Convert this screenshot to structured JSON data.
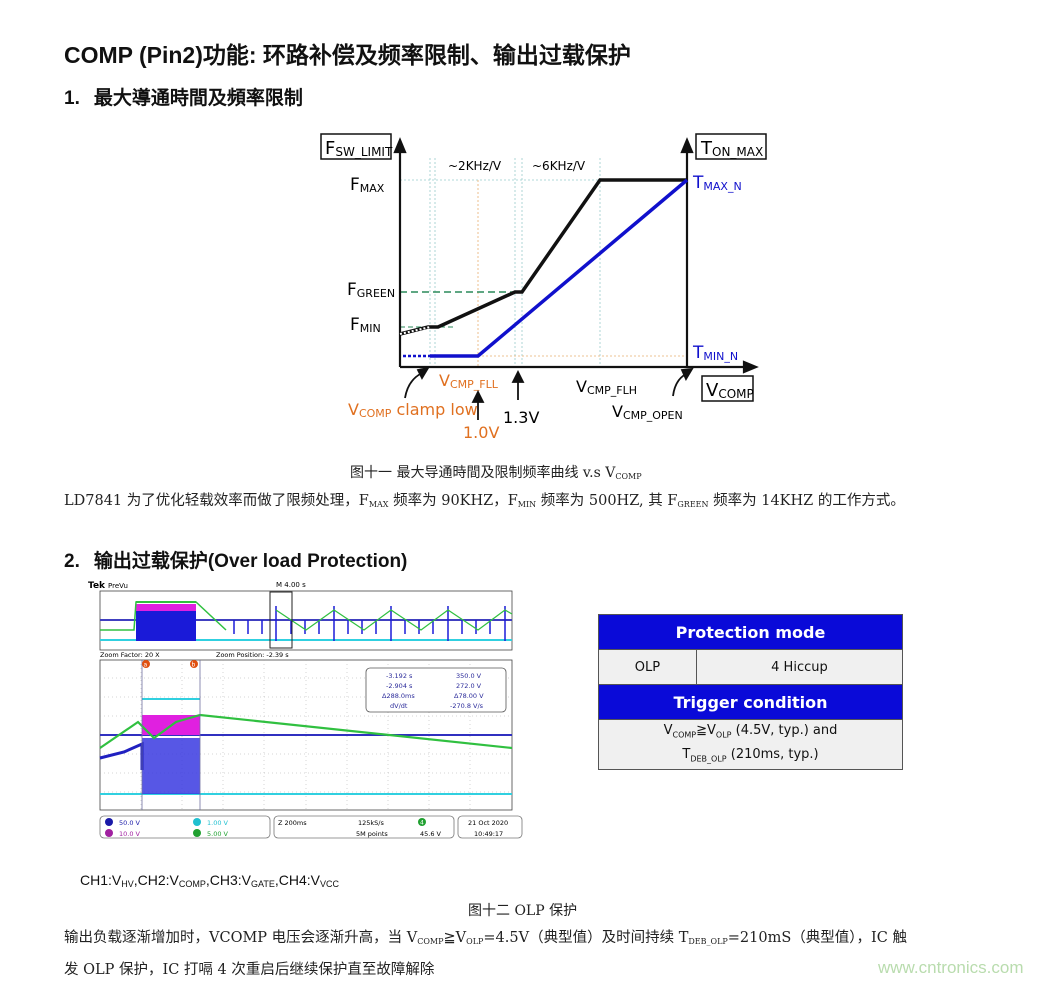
{
  "document": {
    "title": "COMP (Pin2)功能: 环路补偿及频率限制、输出过载保护",
    "section1": {
      "number": "1.",
      "title": "最大導通時間及頻率限制"
    },
    "section2": {
      "number": "2.",
      "title": "输出过载保护(Over load Protection)"
    },
    "figure11_caption": {
      "text": "图十一  最大导通時間及限制频率曲线 v.s V",
      "sub": "COMP"
    },
    "paragraph1": {
      "p1": "LD7841 为了优化轻载效率而做了限频处理，F",
      "s1": "MAX",
      "p2": " 频率为 90KHZ，F",
      "s2": "MIN",
      "p3": " 频率为 500HZ, 其 F",
      "s3": "GREEN",
      "p4": " 频率为 14KHZ 的工作方式。"
    },
    "channel_legend": {
      "t1": "CH1:V",
      "s1": "HV",
      "t2": ",CH2:V",
      "s2": "COMP",
      "t3": ",CH3:V",
      "s3": "GATE",
      "t4": ",CH4:V",
      "s4": "VCC"
    },
    "figure12_caption": "图十二 OLP 保护",
    "paragraph2": {
      "line1a": "输出负载逐渐增加时，VCOMP 电压会逐渐升高，当 V",
      "s1": "COMP",
      "line1b": "≧V",
      "s2": "OLP",
      "line1c": "=4.5V（典型值）及时间持续 T",
      "s3": "DEB_OLP",
      "line1d": "=210mS（典型值），IC 触",
      "line2": "发 OLP 保护，IC 打嗝 4 次重启后继续保护直至故障解除"
    },
    "watermark": "www.cntronics.com"
  },
  "diagram": {
    "y_axis_label": {
      "main": "F",
      "sub": "SW_LIMIT"
    },
    "y2_axis_label": {
      "main": "T",
      "sub": "ON_MAX"
    },
    "x_axis_label": {
      "main": "V",
      "sub": "COMP"
    },
    "fmax": {
      "main": "F",
      "sub": "MAX"
    },
    "fgreen": {
      "main": "F",
      "sub": "GREEN"
    },
    "fmin": {
      "main": "F",
      "sub": "MIN"
    },
    "tmax": {
      "main": "T",
      "sub": "MAX_N"
    },
    "tmin": {
      "main": "T",
      "sub": "MIN_N"
    },
    "slope1": "~2KHz/V",
    "slope2": "~6KHz/V",
    "vcmp_fll": {
      "main": "V",
      "sub": "CMP_FLL"
    },
    "vcmp_flh": {
      "main": "V",
      "sub": "CMP_FLH"
    },
    "vcmp_open": {
      "main": "V",
      "sub": "CMP_OPEN"
    },
    "clamp_low": {
      "main": "V",
      "sub": "COMP",
      "rest": " clamp low"
    },
    "v1": "1.0V",
    "v13": "1.3V",
    "colors": {
      "freq": "#111111",
      "ton": "#1010cc",
      "orange": "#e07020",
      "green_dash": "#2a8a5a"
    }
  },
  "scope": {
    "brand": "Tek",
    "mode": "PreVu",
    "timebase_top": "M 4.00 s",
    "zoom_factor": "Zoom Factor: 20 X",
    "zoom_position": "Zoom Position: -2.39 s",
    "cursors": [
      {
        "label": "a",
        "time": "-3.192 s",
        "value": "350.0 V"
      },
      {
        "label": "b",
        "time": "-2.904 s",
        "value": "272.0 V"
      }
    ],
    "delta_time": "Δ288.0ms",
    "delta_value": "Δ78.00 V",
    "dvdt_label": "dV/dt",
    "dvdt_value": "-270.8 V/s",
    "channels": [
      {
        "n": "1",
        "scale": "50.0 V",
        "color": "#1a1aa8"
      },
      {
        "n": "2",
        "scale": "1.00 V",
        "color": "#20c0d0"
      },
      {
        "n": "3",
        "scale": "10.0 V",
        "color": "#a020a0"
      },
      {
        "n": "4",
        "scale": "5.00 V",
        "color": "#20a030"
      }
    ],
    "zoom_time": "Z 200ms",
    "sample_rate": "125kS/s",
    "record_length": "5M points",
    "trigger_ch": "4",
    "trigger_level": "45.6 V",
    "date": "21 Oct  2020",
    "time": "10:49:17"
  },
  "protection_table": {
    "header1": "Protection mode",
    "mode": "OLP",
    "hiccup": "4 Hiccup",
    "header2": "Trigger condition",
    "cond_line1": {
      "a": "V",
      "s1": "COMP",
      "b": "≧V",
      "s2": "OLP",
      "c": " (4.5V, typ.) and"
    },
    "cond_line2": {
      "a": "T",
      "s1": "DEB_OLP",
      "c": " (210ms, typ.)"
    }
  }
}
